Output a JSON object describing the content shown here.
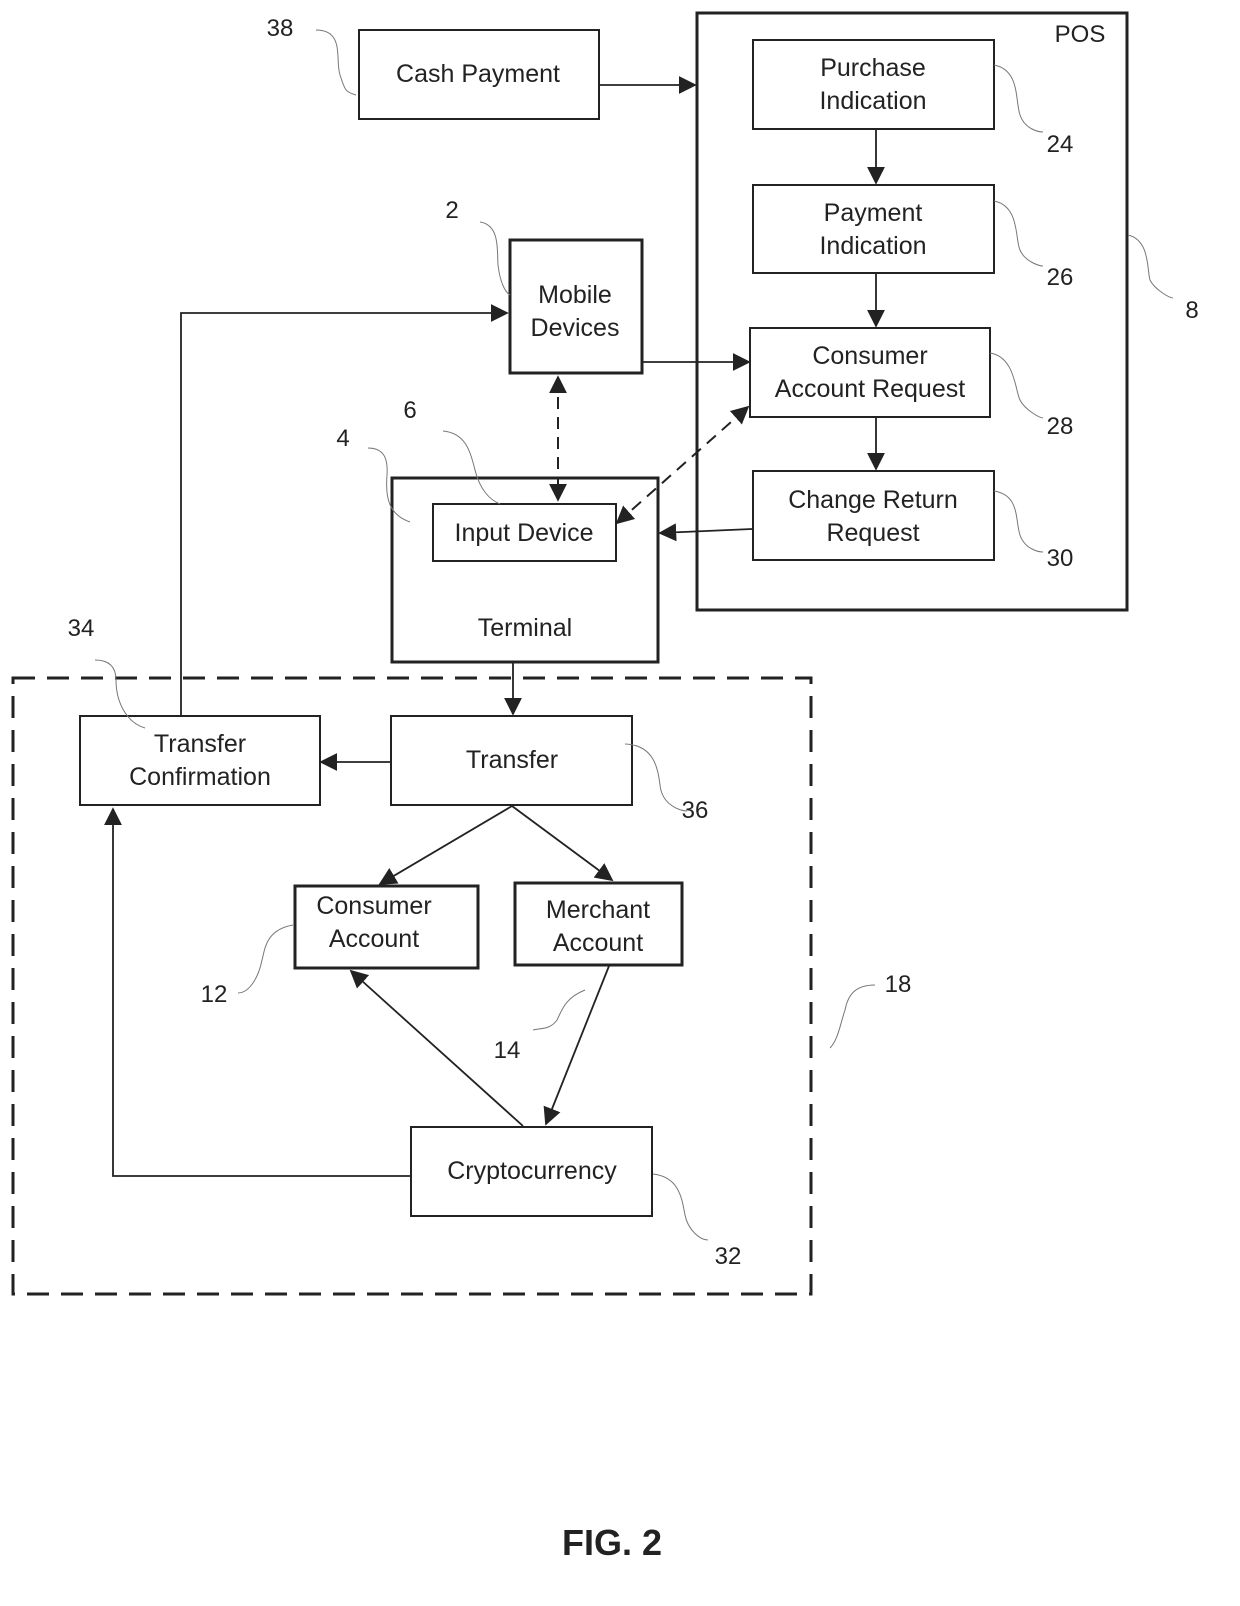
{
  "figure": {
    "caption": "FIG. 2"
  },
  "groups": {
    "pos": {
      "title": "POS",
      "ref": "8"
    },
    "network": {
      "ref": "18"
    },
    "terminal": {
      "title": "Terminal",
      "ref": "4"
    }
  },
  "nodes": {
    "cash_payment": {
      "lines": [
        "Cash Payment"
      ],
      "ref": "38"
    },
    "purchase_indication": {
      "lines": [
        "Purchase",
        "Indication"
      ],
      "ref": "24"
    },
    "payment_indication": {
      "lines": [
        "Payment",
        "Indication"
      ],
      "ref": "26"
    },
    "consumer_account_request": {
      "lines": [
        "Consumer",
        "Account Request"
      ],
      "ref": "28"
    },
    "change_return_request": {
      "lines": [
        "Change Return",
        "Request"
      ],
      "ref": "30"
    },
    "mobile_devices": {
      "lines": [
        "Mobile",
        "Devices"
      ],
      "ref": "2"
    },
    "input_device": {
      "lines": [
        "Input Device"
      ],
      "ref": "6"
    },
    "transfer_confirmation": {
      "lines": [
        "Transfer",
        "Confirmation"
      ],
      "ref": "34"
    },
    "transfer": {
      "lines": [
        "Transfer"
      ],
      "ref": "36"
    },
    "consumer_account": {
      "lines": [
        "Consumer",
        "Account"
      ],
      "ref": "12"
    },
    "merchant_account": {
      "lines": [
        "Merchant",
        "Account"
      ],
      "ref": "14"
    },
    "cryptocurrency": {
      "lines": [
        "Cryptocurrency"
      ],
      "ref": "32"
    }
  },
  "edges": [
    {
      "from": "cash_payment",
      "to": "pos",
      "style": "solid"
    },
    {
      "from": "purchase_indication",
      "to": "payment_indication",
      "style": "solid"
    },
    {
      "from": "payment_indication",
      "to": "consumer_account_request",
      "style": "solid"
    },
    {
      "from": "consumer_account_request",
      "to": "change_return_request",
      "style": "solid"
    },
    {
      "from": "mobile_devices",
      "to": "consumer_account_request",
      "style": "solid"
    },
    {
      "from": "mobile_devices",
      "to": "input_device",
      "style": "dashed",
      "bidirectional": true
    },
    {
      "from": "input_device",
      "to": "consumer_account_request",
      "style": "dashed",
      "bidirectional": true
    },
    {
      "from": "change_return_request",
      "to": "terminal",
      "style": "solid"
    },
    {
      "from": "terminal",
      "to": "transfer",
      "style": "solid"
    },
    {
      "from": "transfer",
      "to": "transfer_confirmation",
      "style": "solid"
    },
    {
      "from": "transfer",
      "to": "consumer_account",
      "style": "solid"
    },
    {
      "from": "transfer",
      "to": "merchant_account",
      "style": "solid"
    },
    {
      "from": "merchant_account",
      "to": "cryptocurrency",
      "style": "solid"
    },
    {
      "from": "cryptocurrency",
      "to": "consumer_account",
      "style": "solid"
    },
    {
      "from": "cryptocurrency",
      "to": "transfer_confirmation",
      "style": "solid"
    },
    {
      "from": "transfer_confirmation",
      "to": "mobile_devices",
      "style": "solid"
    }
  ]
}
